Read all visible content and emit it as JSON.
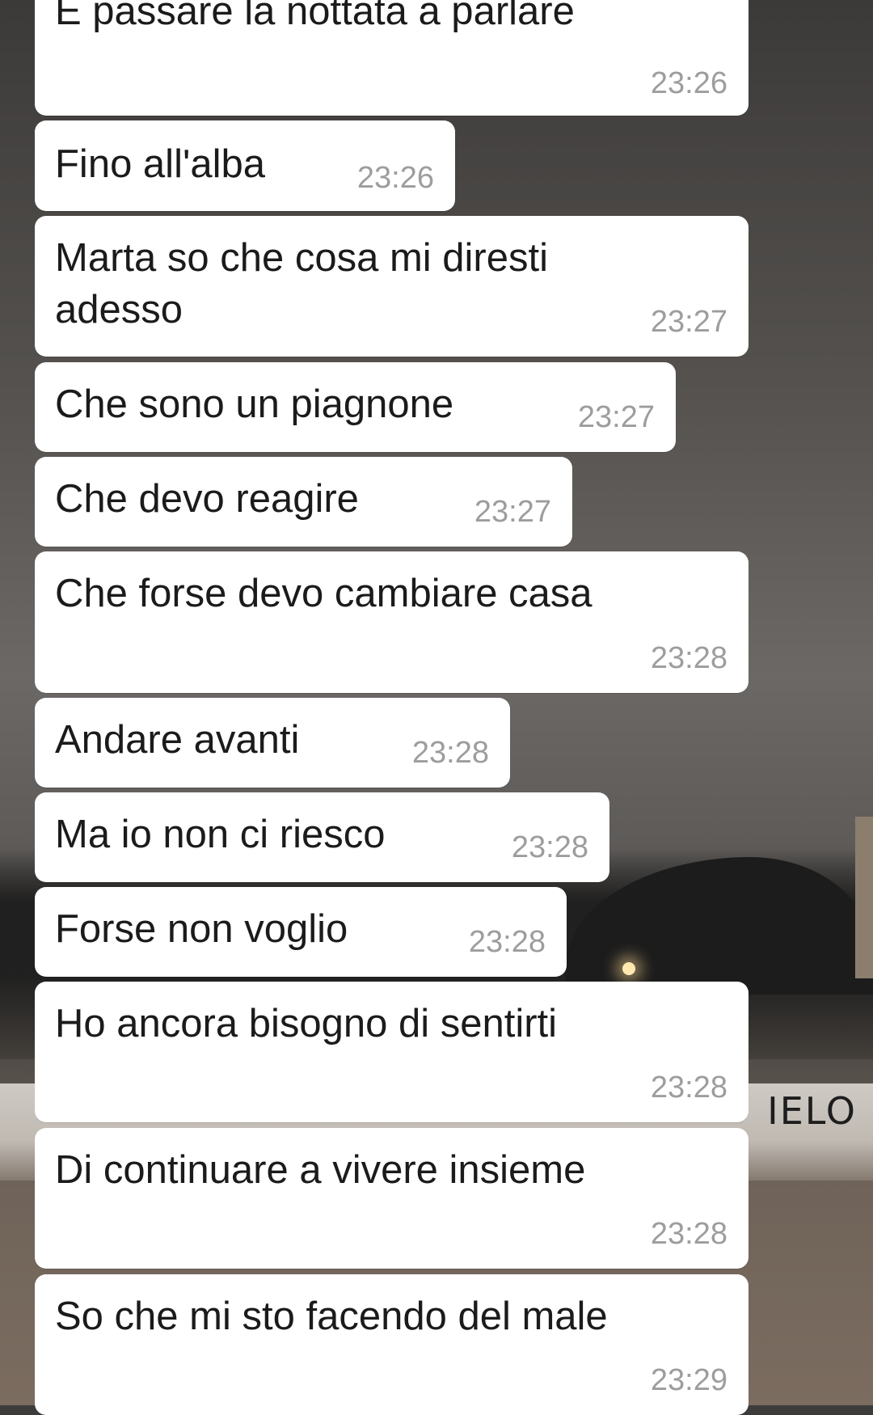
{
  "messages": [
    {
      "text": "E passare la nottata a parlare",
      "time": "23:26"
    },
    {
      "text": "Fino all'alba",
      "time": "23:26"
    },
    {
      "text": "Marta so che cosa mi diresti adesso",
      "time": "23:27"
    },
    {
      "text": "Che sono un piagnone",
      "time": "23:27"
    },
    {
      "text": "Che devo reagire",
      "time": "23:27"
    },
    {
      "text": "Che forse devo cambiare casa",
      "time": "23:28"
    },
    {
      "text": "Andare avanti",
      "time": "23:28"
    },
    {
      "text": "Ma io non ci riesco",
      "time": "23:28"
    },
    {
      "text": "Forse non voglio",
      "time": "23:28"
    },
    {
      "text": "Ho ancora bisogno di sentirti",
      "time": "23:28"
    },
    {
      "text": "Di continuare a vivere insieme",
      "time": "23:28"
    },
    {
      "text": "So che mi sto facendo del male",
      "time": "23:29"
    }
  ],
  "background": {
    "graffiti_text": "IELO",
    "bubble_color": "#ffffff",
    "text_color": "#1b1b1b",
    "time_color": "#9d9d9d"
  }
}
